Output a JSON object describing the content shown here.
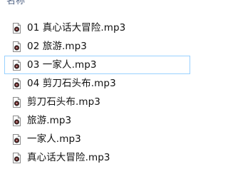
{
  "window": {
    "column_header": "名称"
  },
  "files": [
    {
      "name": "01 真心话大冒险.mp3",
      "icon": "audio-file-icon",
      "focused": false
    },
    {
      "name": "02 旅游.mp3",
      "icon": "audio-file-icon",
      "focused": false
    },
    {
      "name": "03 一家人.mp3",
      "icon": "audio-file-icon",
      "focused": true
    },
    {
      "name": "04 剪刀石头布.mp3",
      "icon": "audio-file-icon",
      "focused": false
    },
    {
      "name": "剪刀石头布.mp3",
      "icon": "audio-file-icon",
      "focused": false
    },
    {
      "name": "旅游.mp3",
      "icon": "audio-file-icon",
      "focused": false
    },
    {
      "name": "一家人.mp3",
      "icon": "audio-file-icon",
      "focused": false
    },
    {
      "name": "真心话大冒险.mp3",
      "icon": "audio-file-icon",
      "focused": false
    }
  ],
  "colors": {
    "focus_border": "#99d1ff",
    "header_text": "#4d6082"
  }
}
